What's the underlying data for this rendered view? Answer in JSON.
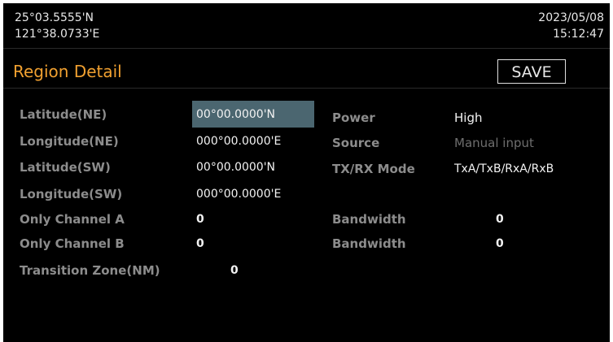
{
  "header": {
    "latitude": "25°03.5555'N",
    "longitude": "121°38.0733'E",
    "date": "2023/05/08",
    "time": "15:12:47"
  },
  "page": {
    "title": "Region Detail",
    "save_label": "SAVE"
  },
  "fields_left": [
    {
      "label": "Latitude(NE)",
      "value": "00°00.0000'N"
    },
    {
      "label": "Longitude(NE)",
      "value": "000°00.0000'E"
    },
    {
      "label": "Latitude(SW)",
      "value": "00°00.0000'N"
    },
    {
      "label": "Longitude(SW)",
      "value": "000°00.0000'E"
    },
    {
      "label": "Only Channel A",
      "value": "0"
    },
    {
      "label": "Only Channel B",
      "value": "0"
    },
    {
      "label": "Transition Zone(NM)",
      "value": "0"
    }
  ],
  "fields_right": {
    "power": {
      "label": "Power",
      "value": "High"
    },
    "source": {
      "label": "Source",
      "value": "Manual input"
    },
    "txrx": {
      "label": "TX/RX Mode",
      "value": "TxA/TxB/RxA/RxB"
    },
    "bandwidth_a": {
      "label": "Bandwidth",
      "value": "0"
    },
    "bandwidth_b": {
      "label": "Bandwidth",
      "value": "0"
    }
  },
  "colors": {
    "accent": "#f0a030",
    "selected_bg": "#4b6670",
    "background": "#000000"
  }
}
